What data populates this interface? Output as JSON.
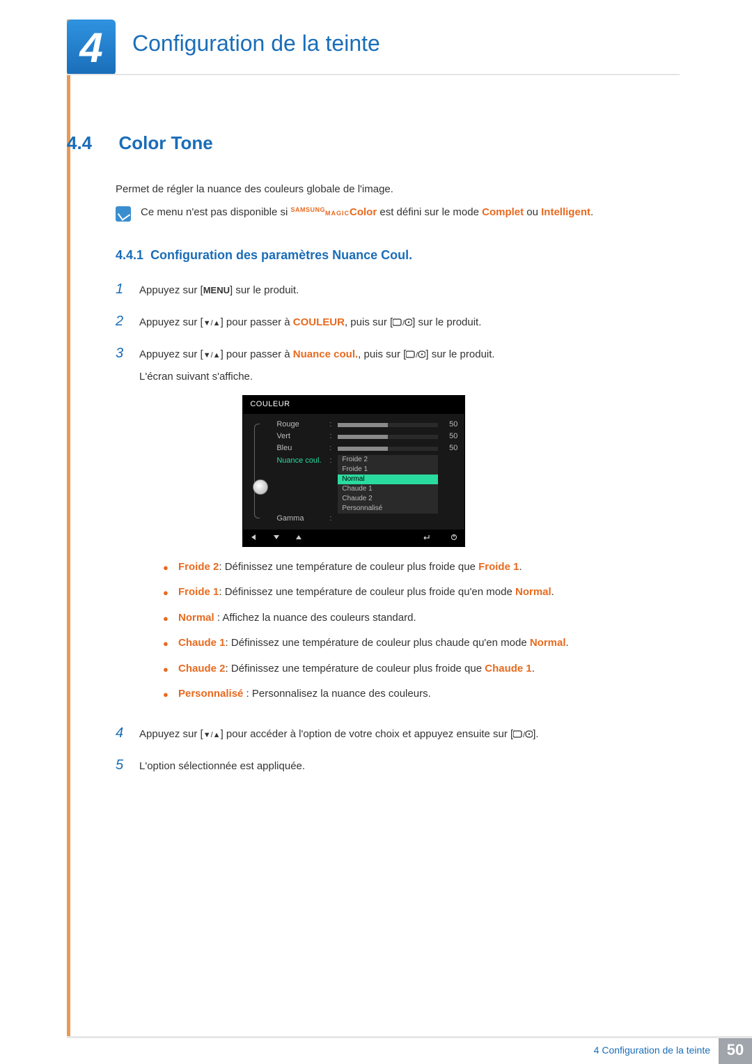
{
  "chapter": {
    "number": "4",
    "title": "Configuration de la teinte"
  },
  "section": {
    "number": "4.4",
    "title": "Color Tone"
  },
  "intro": "Permet de régler la nuance des couleurs globale de l'image.",
  "note": {
    "pre": "Ce menu n'est pas disponible si ",
    "brand_top": "SAMSUNG",
    "brand_bot": "MAGIC",
    "brand_word": "Color",
    "mid": " est défini sur le mode ",
    "m1": "Complet",
    "or": " ou ",
    "m2": "Intelligent",
    "end": "."
  },
  "subsection": {
    "number": "4.4.1",
    "title": "Configuration des paramètres Nuance Coul."
  },
  "steps": {
    "s1": {
      "num": "1",
      "a": "Appuyez sur [",
      "menu": "MENU",
      "b": "] sur le produit."
    },
    "s2": {
      "num": "2",
      "a": "Appuyez sur [",
      "b": "] pour passer à ",
      "target": "COULEUR",
      "c": ", puis sur [",
      "d": "] sur le produit."
    },
    "s3": {
      "num": "3",
      "a": "Appuyez sur [",
      "b": "] pour passer à ",
      "target": "Nuance coul.",
      "c": ", puis sur [",
      "d": "] sur le produit.",
      "line2": "L'écran suivant s'affiche."
    },
    "s4": {
      "num": "4",
      "a": "Appuyez sur [",
      "b": "] pour accéder à l'option de votre choix et appuyez ensuite sur [",
      "c": "]."
    },
    "s5": {
      "num": "5",
      "text": "L'option sélectionnée est appliquée."
    }
  },
  "osd": {
    "title": "COULEUR",
    "rows": [
      {
        "label": "Rouge",
        "value": "50"
      },
      {
        "label": "Vert",
        "value": "50"
      },
      {
        "label": "Bleu",
        "value": "50"
      }
    ],
    "active_label": "Nuance coul.",
    "gamma_label": "Gamma",
    "options": [
      "Froide 2",
      "Froide 1",
      "Normal",
      "Chaude 1",
      "Chaude 2",
      "Personnalisé"
    ],
    "selected": "Normal"
  },
  "bullets": [
    {
      "term": "Froide 2",
      "sep": ": ",
      "text": "Définissez une température de couleur plus froide que ",
      "ref": "Froide 1",
      "tail": "."
    },
    {
      "term": "Froide 1",
      "sep": ": ",
      "text": "Définissez une température de couleur plus froide qu'en mode ",
      "ref": "Normal",
      "tail": "."
    },
    {
      "term": "Normal",
      "sep": " : ",
      "text": "Affichez la nuance des couleurs standard.",
      "ref": "",
      "tail": ""
    },
    {
      "term": "Chaude 1",
      "sep": ": ",
      "text": "Définissez une température de couleur plus chaude qu'en mode ",
      "ref": "Normal",
      "tail": "."
    },
    {
      "term": "Chaude 2",
      "sep": ": ",
      "text": "Définissez une température de couleur plus froide que ",
      "ref": "Chaude 1",
      "tail": "."
    },
    {
      "term": "Personnalisé",
      "sep": " : ",
      "text": "Personnalisez la nuance des couleurs.",
      "ref": "",
      "tail": ""
    }
  ],
  "footer": {
    "text": "4 Configuration de la teinte",
    "page": "50"
  }
}
